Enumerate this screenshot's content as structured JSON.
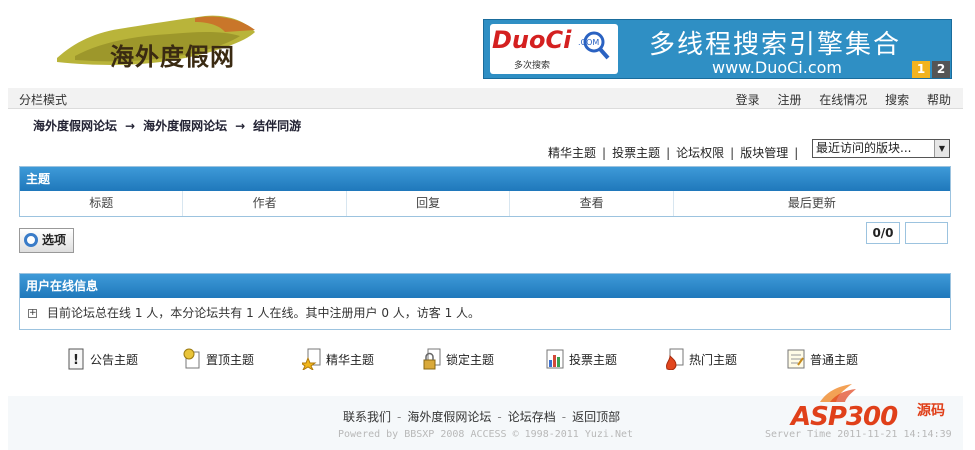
{
  "header": {
    "logo_text": "海外度假网",
    "banner": {
      "brand": "DuoCi",
      "brand_com": ".COM",
      "brand_sub": "多次搜索",
      "slogan": "多线程搜索引擎集合",
      "url": "www.DuoCi.com",
      "pages": [
        "1",
        "2"
      ]
    }
  },
  "navbar": {
    "mode_label": "分栏模式",
    "links": [
      "登录",
      "注册",
      "在线情况",
      "搜索",
      "帮助"
    ]
  },
  "breadcrumb": {
    "items": [
      "海外度假网论坛",
      "海外度假网论坛",
      "结伴同游"
    ],
    "separator": "→"
  },
  "actions": {
    "links": [
      "精华主题",
      "投票主题",
      "论坛权限",
      "版块管理"
    ],
    "select_value": "最近访问的版块..."
  },
  "topic_panel": {
    "title": "主题",
    "columns": [
      "标题",
      "作者",
      "回复",
      "查看",
      "最后更新"
    ]
  },
  "controls": {
    "options_label": "选项",
    "page_count": "0/0"
  },
  "online_panel": {
    "title": "用户在线信息",
    "text": "目前论坛总在线 1 人，本分论坛共有 1 人在线。其中注册用户 0 人，访客 1 人。"
  },
  "legend": {
    "items": [
      {
        "label": "公告主题",
        "icon": "announcement-icon"
      },
      {
        "label": "置顶主题",
        "icon": "pinned-icon"
      },
      {
        "label": "精华主题",
        "icon": "featured-star-icon"
      },
      {
        "label": "锁定主题",
        "icon": "lock-icon"
      },
      {
        "label": "投票主题",
        "icon": "poll-chart-icon"
      },
      {
        "label": "热门主题",
        "icon": "hot-topic-icon"
      },
      {
        "label": "普通主题",
        "icon": "document-icon"
      }
    ]
  },
  "footer": {
    "links": [
      "联系我们",
      "海外度假网论坛",
      "论坛存档",
      "返回顶部"
    ],
    "separator": "-",
    "powered": "Powered by BBSXP 2008 ACCESS © 1998-2011 Yuzi.Net",
    "server_time": "Server Time 2011-11-21 14:14:39",
    "watermark": "ASP300",
    "watermark_sub": "源码"
  },
  "colors": {
    "panel_header": "#1f78bb",
    "panel_border": "#9cc3df",
    "banner_bg": "#2f8fc4",
    "watermark": "#e0401a"
  }
}
